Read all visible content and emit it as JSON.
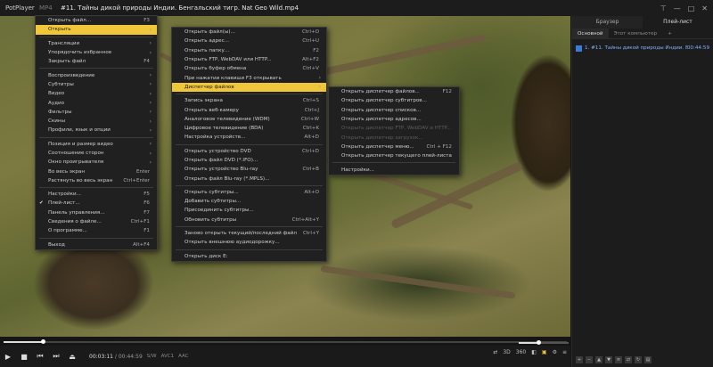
{
  "titlebar": {
    "app_name": "PotPlayer",
    "format": "MP4",
    "title": "#11. Тайны дикой природы Индии. Бенгальский тигр. Nat Geo Wild.mp4"
  },
  "main_menu": [
    {
      "label": "Открыть файл...",
      "shortcut": "F3"
    },
    {
      "label": "Открыть",
      "arrow": true,
      "highlight": true
    },
    {
      "sep": true
    },
    {
      "label": "Трансляции",
      "arrow": true
    },
    {
      "label": "Упорядочить избранное",
      "arrow": true
    },
    {
      "label": "Закрыть файл",
      "shortcut": "F4"
    },
    {
      "sep": true
    },
    {
      "label": "Воспроизведение",
      "arrow": true
    },
    {
      "label": "Субтитры",
      "arrow": true
    },
    {
      "label": "Видео",
      "arrow": true
    },
    {
      "label": "Аудио",
      "arrow": true
    },
    {
      "label": "Фильтры",
      "arrow": true
    },
    {
      "label": "Скины",
      "arrow": true
    },
    {
      "label": "Профили, язык и опции",
      "arrow": true
    },
    {
      "sep": true
    },
    {
      "label": "Позиция и размер видео",
      "arrow": true
    },
    {
      "label": "Соотношение сторон",
      "arrow": true
    },
    {
      "label": "Окно проигрывателя",
      "arrow": true
    },
    {
      "label": "Во весь экран",
      "shortcut": "Enter"
    },
    {
      "label": "Растянуть во весь экран",
      "shortcut": "Ctrl+Enter"
    },
    {
      "sep": true
    },
    {
      "label": "Настройки...",
      "shortcut": "F5"
    },
    {
      "label": "Плей-лист...",
      "shortcut": "F6",
      "check": true
    },
    {
      "label": "Панель управления...",
      "shortcut": "F7"
    },
    {
      "label": "Сведения о файле...",
      "shortcut": "Ctrl+F1"
    },
    {
      "label": "О программе...",
      "shortcut": "F1"
    },
    {
      "sep": true
    },
    {
      "label": "Выход",
      "shortcut": "Alt+F4"
    }
  ],
  "open_menu": [
    {
      "label": "Открыть файл(ы)...",
      "shortcut": "Ctrl+O"
    },
    {
      "label": "Открыть адрес...",
      "shortcut": "Ctrl+U"
    },
    {
      "label": "Открыть папку...",
      "shortcut": "F2"
    },
    {
      "label": "Открыть FTP, WebDAV или HTTP...",
      "shortcut": "Alt+F2"
    },
    {
      "label": "Открыть буфер обмена",
      "shortcut": "Ctrl+V"
    },
    {
      "label": "При нажатии клавиши F3 открывать",
      "arrow": true
    },
    {
      "label": "Диспетчер файлов",
      "arrow": true,
      "highlight": true
    },
    {
      "sep": true
    },
    {
      "label": "Запись экрана",
      "shortcut": "Ctrl+S"
    },
    {
      "label": "Открыть веб-камеру",
      "shortcut": "Ctrl+J"
    },
    {
      "label": "Аналоговое телевидение (WDM)",
      "shortcut": "Ctrl+W"
    },
    {
      "label": "Цифровое телевидение (BDA)",
      "shortcut": "Ctrl+K"
    },
    {
      "label": "Настройка устройств...",
      "shortcut": "Alt+D"
    },
    {
      "sep": true
    },
    {
      "label": "Открыть устройство DVD",
      "shortcut": "Ctrl+D"
    },
    {
      "label": "Открыть файл DVD (*.IFO)...",
      "shortcut": ""
    },
    {
      "label": "Открыть устройство Blu-ray",
      "shortcut": "Ctrl+B"
    },
    {
      "label": "Открыть файл Blu-ray (*.MPLS)...",
      "shortcut": ""
    },
    {
      "sep": true
    },
    {
      "label": "Открыть субтитры...",
      "shortcut": "Alt+O"
    },
    {
      "label": "Добавить субтитры...",
      "shortcut": ""
    },
    {
      "label": "Присоединить субтитры...",
      "shortcut": ""
    },
    {
      "label": "Обновить субтитры",
      "shortcut": "Ctrl+Alt+Y"
    },
    {
      "sep": true
    },
    {
      "label": "Заново открыть текущий/последний файл",
      "shortcut": "Ctrl+Y"
    },
    {
      "label": "Открыть внешнюю аудиодорожку...",
      "shortcut": ""
    },
    {
      "sep": true
    },
    {
      "label": "Открыть диск E:",
      "shortcut": ""
    }
  ],
  "file_manager_menu": [
    {
      "label": "Открыть диспетчер файлов...",
      "shortcut": "F12"
    },
    {
      "label": "Открыть диспетчер субтитров...",
      "shortcut": ""
    },
    {
      "label": "Открыть диспетчер списков...",
      "shortcut": ""
    },
    {
      "label": "Открыть диспетчер адресов...",
      "shortcut": ""
    },
    {
      "label": "Открыть диспетчер FTP, WebDAV и HTTP...",
      "shortcut": "",
      "disabled": true
    },
    {
      "label": "Открыть диспетчер загрузок...",
      "shortcut": "",
      "disabled": true
    },
    {
      "label": "Открыть диспетчер меню...",
      "shortcut": "Ctrl + F12"
    },
    {
      "label": "Открыть диспетчер текущего плей-листа",
      "shortcut": ""
    },
    {
      "sep": true
    },
    {
      "label": "Настройки...",
      "shortcut": ""
    }
  ],
  "controls": {
    "current_time": "00:03:11",
    "duration": "00:44:59",
    "tags": [
      "S/W",
      "AVC1",
      "AAC"
    ],
    "right_labels": [
      "3D",
      "360"
    ],
    "seek_progress": 0.07
  },
  "panel": {
    "tabs": [
      "Браузер",
      "Плей-лист"
    ],
    "active_tab": 1,
    "subtabs": [
      "Основной",
      "Этот компьютер",
      "+"
    ],
    "items": [
      {
        "name": "1. #11. Тайны дикой природы Индии. Бе...",
        "duration": "00:44:59"
      }
    ]
  },
  "colors": {
    "highlight": "#f0c63a",
    "playlist_link": "#7fb2ff"
  }
}
